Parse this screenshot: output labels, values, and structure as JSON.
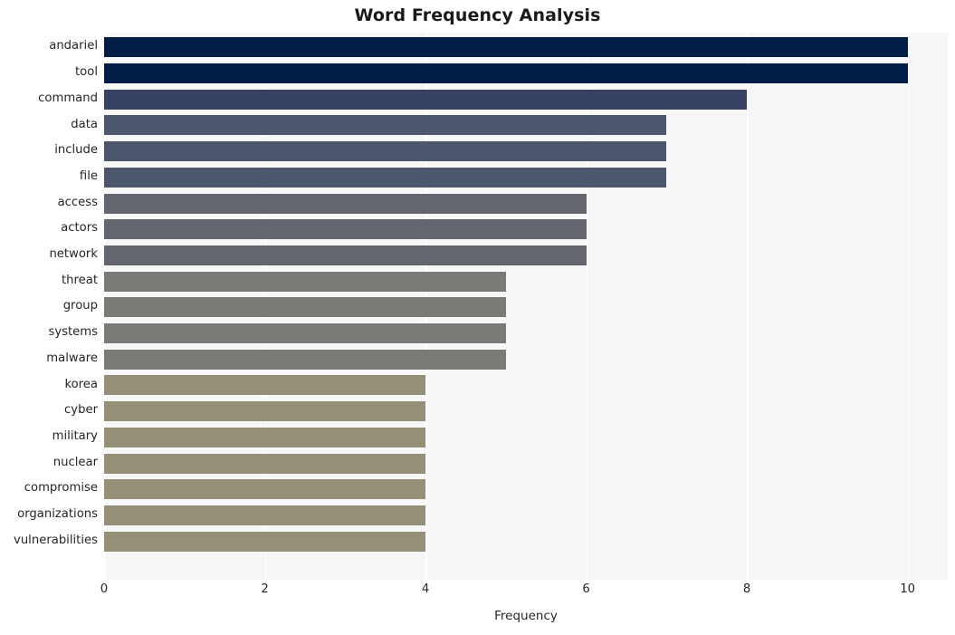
{
  "chart_data": {
    "type": "bar",
    "orientation": "horizontal",
    "title": "Word Frequency Analysis",
    "xlabel": "Frequency",
    "ylabel": "",
    "xlim": [
      0,
      10.5
    ],
    "xticks": [
      0,
      2,
      4,
      6,
      8,
      10
    ],
    "xtick_labels": [
      "0",
      "2",
      "4",
      "6",
      "8",
      "10"
    ],
    "grid": true,
    "grid_axis": "x",
    "legend": null,
    "categories": [
      "andariel",
      "tool",
      "command",
      "data",
      "include",
      "file",
      "access",
      "actors",
      "network",
      "threat",
      "group",
      "systems",
      "malware",
      "korea",
      "cyber",
      "military",
      "nuclear",
      "compromise",
      "organizations",
      "vulnerabilities"
    ],
    "values": [
      10,
      10,
      8,
      7,
      7,
      7,
      6,
      6,
      6,
      5,
      5,
      5,
      5,
      4,
      4,
      4,
      4,
      4,
      4,
      4
    ],
    "bar_colors": [
      "#021E47",
      "#021E47",
      "#374264",
      "#4C566D",
      "#4C566D",
      "#4C566D",
      "#63666E",
      "#63666E",
      "#63666E",
      "#7B7A77",
      "#7B7A77",
      "#7B7A77",
      "#7B7A77",
      "#968F77",
      "#968F77",
      "#968F77",
      "#968F77",
      "#968F77",
      "#968F77",
      "#968F77"
    ],
    "plot_background": "#f7f7f7",
    "figure_background": "#ffffff",
    "gridline_color": "#ffffff",
    "text_color": "#262626"
  }
}
